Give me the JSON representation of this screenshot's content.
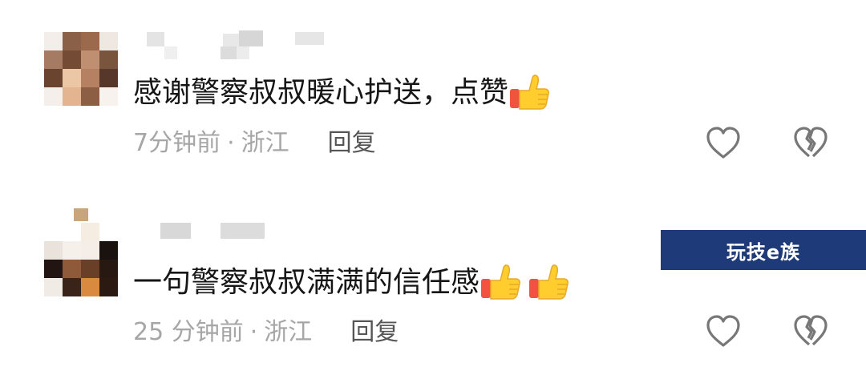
{
  "comments": [
    {
      "text": "感谢警察叔叔暖心护送，点赞",
      "thumbs": 1,
      "time": "7分钟前",
      "separator": "·",
      "location": "浙江",
      "reply_label": "回复"
    },
    {
      "text": "一句警察叔叔满满的信任感",
      "thumbs": 2,
      "time": "25 分钟前",
      "separator": "·",
      "location": "浙江",
      "reply_label": "回复"
    }
  ],
  "icons": {
    "like": "heart-outline-icon",
    "dislike": "broken-heart-icon",
    "emoji": "thumbs-up-emoji"
  },
  "watermark": {
    "text": "玩技e族",
    "bg_color": "#1e3a78"
  },
  "colors": {
    "text": "#161616",
    "meta": "#a6a6a6",
    "reply": "#555555"
  }
}
